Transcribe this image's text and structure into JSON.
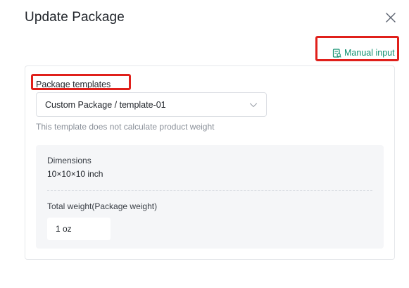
{
  "dialog": {
    "title": "Update Package",
    "close_icon": "close-icon"
  },
  "manual_input": {
    "label": "Manual input",
    "icon": "edit-doc-icon",
    "color": "#0e8f6e"
  },
  "package_templates": {
    "label": "Package templates",
    "selected": "Custom Package / template-01",
    "hint": "This template does not calculate product weight"
  },
  "details": {
    "dimensions_label": "Dimensions",
    "dimensions_value": "10×10×10 inch",
    "weight_label": "Total weight(Package weight)",
    "weight_value": "1 oz"
  },
  "highlight_color": "#e0201b"
}
